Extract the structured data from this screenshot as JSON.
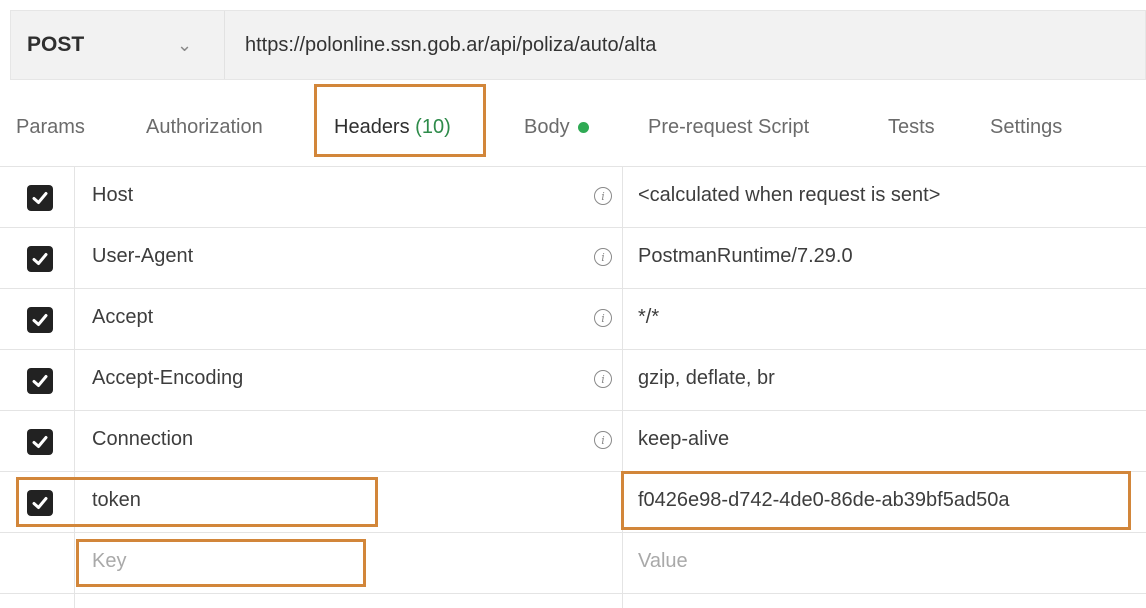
{
  "request": {
    "method": "POST",
    "url": "https://polonline.ssn.gob.ar/api/poliza/auto/alta"
  },
  "tabs": [
    {
      "label": "Params"
    },
    {
      "label": "Authorization"
    },
    {
      "label": "Headers",
      "count": "(10)"
    },
    {
      "label": "Body"
    },
    {
      "label": "Pre-request Script"
    },
    {
      "label": "Tests"
    },
    {
      "label": "Settings"
    }
  ],
  "headers": [
    {
      "key": "Host",
      "value": "<calculated when request is sent>",
      "checked": true
    },
    {
      "key": "User-Agent",
      "value": "PostmanRuntime/7.29.0",
      "checked": true
    },
    {
      "key": "Accept",
      "value": "*/*",
      "checked": true
    },
    {
      "key": "Accept-Encoding",
      "value": "gzip, deflate, br",
      "checked": true
    },
    {
      "key": "Connection",
      "value": "keep-alive",
      "checked": true
    },
    {
      "key": "token",
      "value": "f0426e98-d742-4de0-86de-ab39bf5ad50a",
      "checked": true
    }
  ],
  "new_row": {
    "key_placeholder": "Key",
    "value_placeholder": "Value"
  },
  "colors": {
    "highlight": "#d2863a",
    "body_dot": "#2faa54",
    "header_count": "#2e8b4a"
  }
}
